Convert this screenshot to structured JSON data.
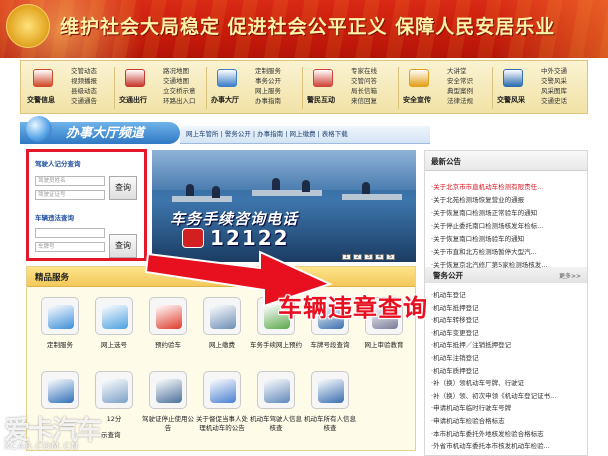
{
  "banner": {
    "slogan": "维护社会大局稳定 促进社会公平正义 保障人民安居乐业"
  },
  "nav": [
    {
      "title": "交警信息",
      "icon": "tv-icon",
      "links": [
        "交管动态",
        "视频播报",
        "县级动态",
        "交通通告"
      ]
    },
    {
      "title": "交通出行",
      "icon": "train-icon",
      "links": [
        "路况地图",
        "交通地图",
        "立交桥示意",
        "环路出入口"
      ]
    },
    {
      "title": "办事大厅",
      "icon": "hall-icon",
      "links": [
        "定制服务",
        "事务公开",
        "网上服务",
        "办事指南"
      ]
    },
    {
      "title": "警民互动",
      "icon": "people-icon",
      "links": [
        "专家在线",
        "交管问答",
        "局长信箱",
        "来信回复"
      ]
    },
    {
      "title": "安全宣传",
      "icon": "warning-icon",
      "links": [
        "大讲堂",
        "安全常识",
        "典型案例",
        "法律法规"
      ]
    },
    {
      "title": "交警风采",
      "icon": "police-icon",
      "links": [
        "中外交通",
        "交警风采",
        "风采图库",
        "交通史话"
      ]
    }
  ],
  "channel": {
    "title": "办事大厅频道",
    "links": "网上车管所 | 警务公开 | 办事指南 | 网上缴费 | 表格下载"
  },
  "query": {
    "license_title": "驾驶人记分查询",
    "license_placeholder": "驾驶员姓名",
    "cert_placeholder": "驾驶证证号",
    "button1": "查询",
    "vehicle_title": "车辆违法查询",
    "plate_placeholder": "车牌号",
    "vin_placeholder": "",
    "button2": "查询"
  },
  "photo": {
    "caption1": "车务手续咨询电话",
    "caption2": "12122",
    "pages": [
      "1",
      "2",
      "3",
      "4",
      "5"
    ]
  },
  "services": {
    "title": "精品服务",
    "items": [
      {
        "label": "定制服务",
        "icon": "custom-service-icon",
        "color": "#3d8fd9"
      },
      {
        "label": "网上选号",
        "icon": "plate-select-icon",
        "color": "#4aa0e0"
      },
      {
        "label": "预约验车",
        "icon": "inspection-icon",
        "color": "#de3b2a"
      },
      {
        "label": "网上缴费",
        "icon": "payment-icon",
        "color": "#6b8fb5"
      },
      {
        "label": "车务手续网上预约",
        "icon": "booking-icon",
        "color": "#5aa84a"
      },
      {
        "label": "车牌号段查询",
        "icon": "plate-range-icon",
        "color": "#3b6fb0"
      },
      {
        "label": "网上审验教育",
        "icon": "education-icon",
        "color": "#7a7a9a"
      },
      {
        "label": "",
        "icon": "car-icon",
        "color": "#2f6fb8"
      },
      {
        "label": "12分",
        "icon": "score-icon",
        "color": "#7aa0c8"
      },
      {
        "label": "驾驶证停止使用公告",
        "icon": "license-notice-icon",
        "color": "#4a6f9a"
      },
      {
        "label": "关于督促当事人处理机动车的公告",
        "icon": "notice-icon",
        "color": "#4a7fd0"
      },
      {
        "label": "机动车驾驶人信息核查",
        "icon": "driver-check-icon",
        "color": "#5f88b8"
      },
      {
        "label": "机动车所有人信息核查",
        "icon": "owner-check-icon",
        "color": "#3a6db0"
      }
    ],
    "partial_label": "示查询"
  },
  "notice": {
    "title": "最新公告",
    "items": [
      "·关于北京市市直机动车检测有限责任...",
      "·关于北苑检测场恢复营业的通报",
      "·关于恢复南口检测场正常验车的通知",
      "·关于停止委托南口检测场核发年检标...",
      "·关于恢复南口检测场验车的通知",
      "·关于市直和北方检测场暂停大型汽...",
      "·关于恢复京北汽修厂第5家检测场核发..."
    ],
    "section2_title": "警务公开",
    "more": "更多>>",
    "items2": [
      "·机动车登记",
      "·机动车抵押登记",
      "·机动车转移登记",
      "·机动车变更登记",
      "·机动车抵押／注销抵押登记",
      "·机动车注销登记",
      "·机动车质押登记",
      "·补（换）领机动车号牌、行驶证",
      "·补（换）领、初次申领《机动车登记证书...",
      "·申请机动车临时行驶车号牌",
      "·申请机动车检验合格标志",
      "·本市机动车委托外地核发检验合格标志",
      "·外省市机动车委托本市核发机动车检验..."
    ]
  },
  "annotation": {
    "text": "车辆违章查询"
  },
  "watermark": {
    "text1": "爱卡汽车",
    "text2": "XCAR.COM.CN"
  }
}
